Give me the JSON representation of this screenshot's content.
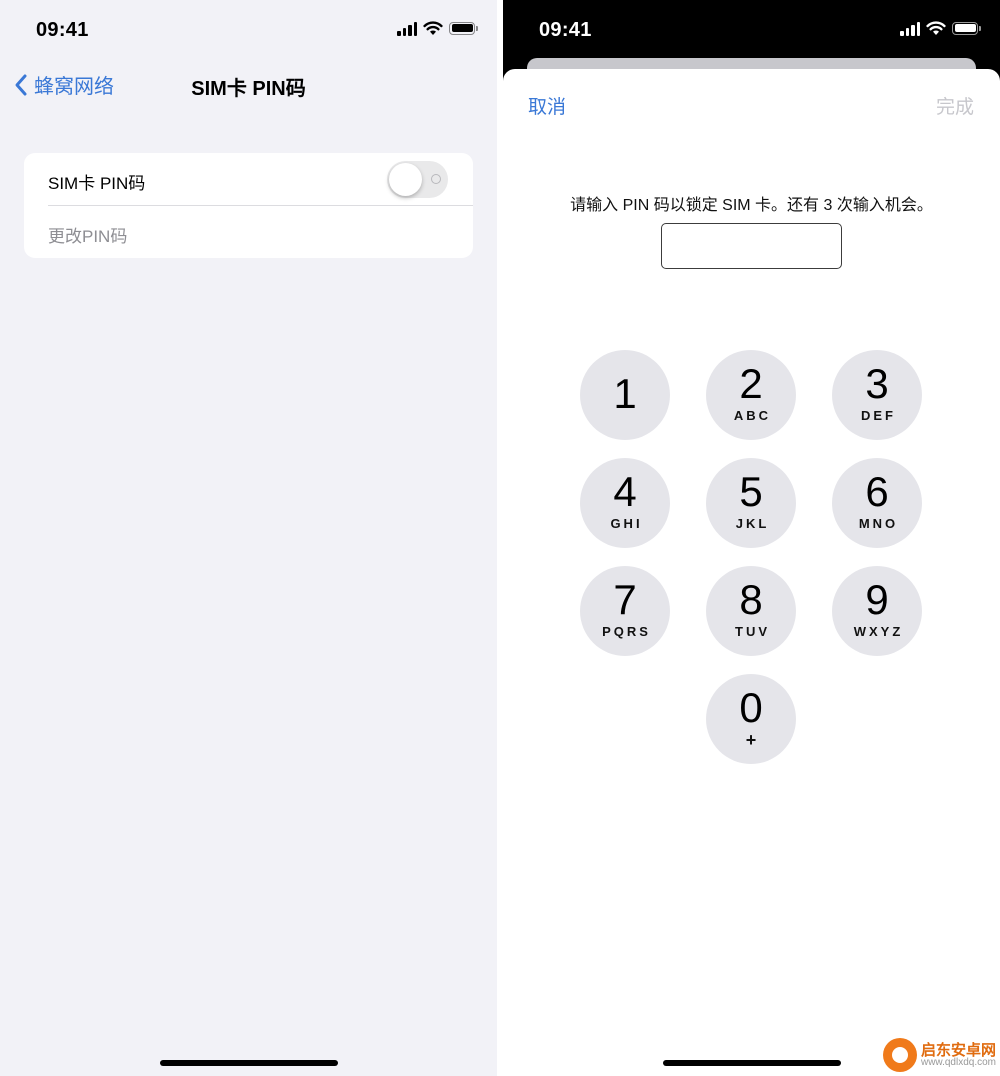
{
  "left_screen": {
    "status_bar": {
      "time": "09:41"
    },
    "nav": {
      "back_label": "蜂窝网络",
      "title": "SIM卡 PIN码"
    },
    "settings": {
      "pin_toggle_label": "SIM卡 PIN码",
      "pin_toggle_on": false,
      "change_pin_label": "更改PIN码"
    }
  },
  "right_screen": {
    "status_bar": {
      "time": "09:41"
    },
    "sheet": {
      "cancel_label": "取消",
      "done_label": "完成",
      "prompt": "请输入 PIN 码以锁定 SIM 卡。还有 3 次输入机会。",
      "pin_value": ""
    },
    "keypad": [
      {
        "digit": "1",
        "letters": ""
      },
      {
        "digit": "2",
        "letters": "ABC"
      },
      {
        "digit": "3",
        "letters": "DEF"
      },
      {
        "digit": "4",
        "letters": "GHI"
      },
      {
        "digit": "5",
        "letters": "JKL"
      },
      {
        "digit": "6",
        "letters": "MNO"
      },
      {
        "digit": "7",
        "letters": "PQRS"
      },
      {
        "digit": "8",
        "letters": "TUV"
      },
      {
        "digit": "9",
        "letters": "WXYZ"
      },
      {
        "digit": "0",
        "letters": "+"
      }
    ]
  },
  "watermark": {
    "name": "启东安卓网",
    "url": "www.qdlxdq.com"
  },
  "colors": {
    "accent": "#3a78d6",
    "disabled": "#c7c7cc",
    "settings_background": "#f2f2f7",
    "key_background": "#e5e5ea"
  },
  "icons": [
    "cellular-signal-icon",
    "wifi-icon",
    "battery-icon",
    "chevron-left-icon"
  ]
}
